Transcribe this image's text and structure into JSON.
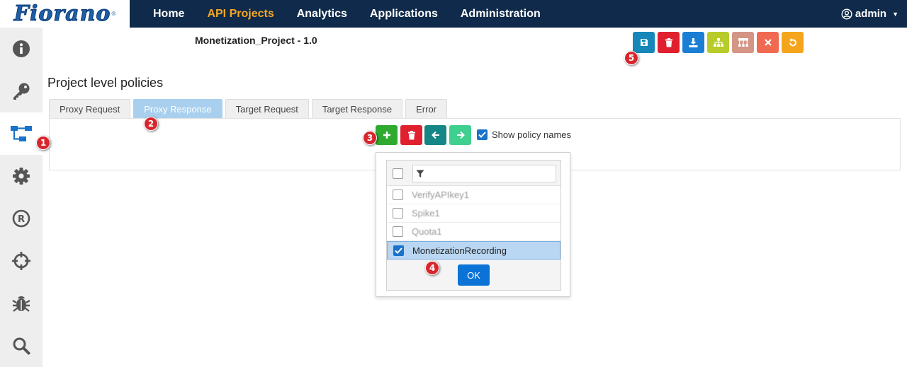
{
  "brand": {
    "logo_text": "Fiorano",
    "logo_mark": "®"
  },
  "nav": {
    "items": [
      {
        "label": "Home",
        "active": false
      },
      {
        "label": "API Projects",
        "active": true
      },
      {
        "label": "Analytics",
        "active": false
      },
      {
        "label": "Applications",
        "active": false
      },
      {
        "label": "Administration",
        "active": false
      }
    ],
    "user_label": "admin"
  },
  "sidebar": {
    "items": [
      {
        "icon": "info-icon",
        "active": false
      },
      {
        "icon": "key-icon",
        "active": false
      },
      {
        "icon": "flow-icon",
        "active": true
      },
      {
        "icon": "gear-icon",
        "active": false
      },
      {
        "icon": "registered-icon",
        "active": false
      },
      {
        "icon": "crosshair-icon",
        "active": false
      },
      {
        "icon": "bug-icon",
        "active": false
      },
      {
        "icon": "search-icon",
        "active": false
      }
    ]
  },
  "project": {
    "title": "Monetization_Project - 1.0"
  },
  "toolbar": {
    "buttons": [
      {
        "icon": "save-icon",
        "color": "#1587b8"
      },
      {
        "icon": "trash-icon",
        "color": "#e0202e"
      },
      {
        "icon": "download-icon",
        "color": "#1a7fd4"
      },
      {
        "icon": "hierarchy-icon",
        "color": "#b7cc2a"
      },
      {
        "icon": "tree-icon",
        "color": "#d49585"
      },
      {
        "icon": "close-icon",
        "color": "#f06a52"
      },
      {
        "icon": "undo-icon",
        "color": "#f5a51c"
      }
    ]
  },
  "section": {
    "title": "Project level policies"
  },
  "tabs": [
    {
      "label": "Proxy Request",
      "active": false
    },
    {
      "label": "Proxy Response",
      "active": true
    },
    {
      "label": "Target Request",
      "active": false
    },
    {
      "label": "Target Response",
      "active": false
    },
    {
      "label": "Error",
      "active": false
    }
  ],
  "policy_toolbar": {
    "buttons": [
      {
        "icon": "plus-icon",
        "color": "#2eaa2e"
      },
      {
        "icon": "trash-icon",
        "color": "#e0202e"
      },
      {
        "icon": "arrow-left-icon",
        "color": "#168585"
      },
      {
        "icon": "arrow-right-icon",
        "color": "#3fcf8e"
      }
    ],
    "show_policy_names_label": "Show policy names",
    "show_policy_names_checked": true
  },
  "dropdown": {
    "filter_placeholder": "",
    "items": [
      {
        "label": "VerifyAPIkey1",
        "checked": false,
        "selected": false
      },
      {
        "label": "Spike1",
        "checked": false,
        "selected": false
      },
      {
        "label": "Quota1",
        "checked": false,
        "selected": false
      },
      {
        "label": "MonetizationRecording",
        "checked": true,
        "selected": true
      }
    ],
    "ok_label": "OK"
  },
  "callouts": [
    "1",
    "2",
    "3",
    "4",
    "5"
  ],
  "colors": {
    "topbar": "#0f2a4a",
    "accent": "#f5a623",
    "primary": "#0b72d6"
  }
}
